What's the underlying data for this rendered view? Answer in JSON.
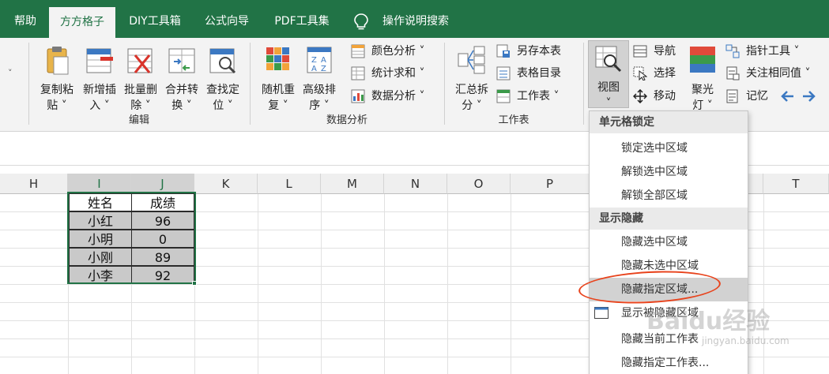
{
  "tabs": [
    "帮助",
    "方方格子",
    "DIY工具箱",
    "公式向导",
    "PDF工具集",
    "操作说明搜索"
  ],
  "ribbon": {
    "edit_group": {
      "label": "编辑",
      "buttons": [
        {
          "line1": "复制粘",
          "line2": "贴 ˅"
        },
        {
          "line1": "新增插",
          "line2": "入 ˅"
        },
        {
          "line1": "批量删",
          "line2": "除 ˅"
        },
        {
          "line1": "合并转",
          "line2": "换 ˅"
        },
        {
          "line1": "查找定",
          "line2": "位 ˅"
        }
      ]
    },
    "data_group": {
      "label": "数据分析",
      "buttons": [
        {
          "line1": "随机重",
          "line2": "复 ˅"
        },
        {
          "line1": "高级排",
          "line2": "序 ˅"
        }
      ],
      "small": [
        "颜色分析 ˅",
        "统计求和 ˅",
        "数据分析 ˅"
      ]
    },
    "sheet_group": {
      "label": "工作表",
      "buttons": [
        {
          "line1": "汇总拆",
          "line2": "分 ˅"
        }
      ],
      "small": [
        "另存本表",
        "表格目录",
        "工作表 ˅"
      ]
    },
    "view_group": {
      "view_button": {
        "line1": "视图",
        "line2": "˅"
      },
      "small": [
        "导航",
        "选择",
        "移动"
      ],
      "spotlight": {
        "line1": "聚光",
        "line2": "灯 ˅"
      },
      "right_small": [
        "指针工具 ˅",
        "关注相同值 ˅",
        "记忆"
      ]
    }
  },
  "grid": {
    "columns": [
      "H",
      "I",
      "J",
      "K",
      "L",
      "M",
      "N",
      "O",
      "P",
      "T"
    ],
    "table": [
      [
        "姓名",
        "成绩"
      ],
      [
        "小红",
        "96"
      ],
      [
        "小明",
        "0"
      ],
      [
        "小刚",
        "89"
      ],
      [
        "小李",
        "92"
      ]
    ]
  },
  "dropdown": {
    "section1": "单元格锁定",
    "items1": [
      "锁定选中区域",
      "解锁选中区域",
      "解锁全部区域"
    ],
    "section2": "显示隐藏",
    "items2": [
      "隐藏选中区域",
      "隐藏未选中区域",
      "隐藏指定区域...",
      "显示被隐藏区域",
      "隐藏当前工作表",
      "隐藏指定工作表..."
    ]
  },
  "watermark": "Baidu经验",
  "watermark_sub": "jingyan.baidu.com",
  "colors": {
    "excel_green": "#217346",
    "highlight_red": "#e8431c"
  }
}
